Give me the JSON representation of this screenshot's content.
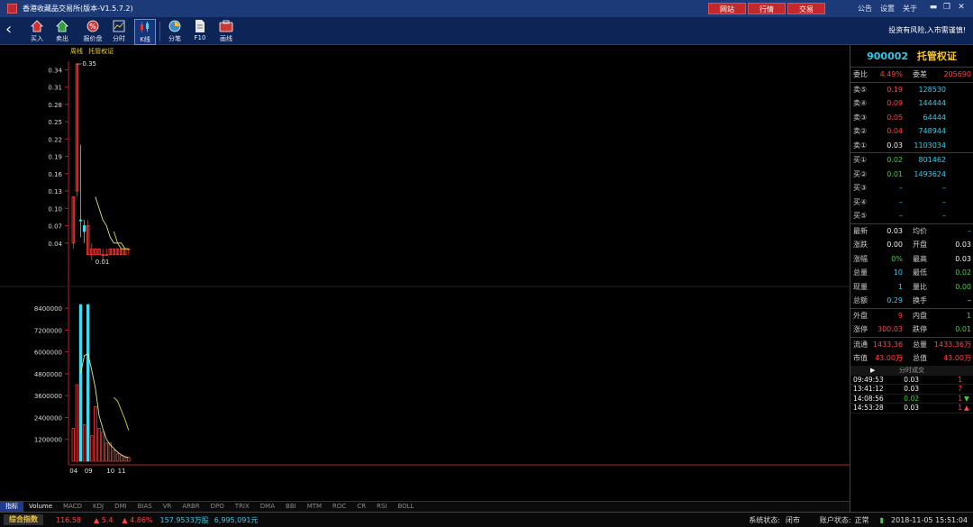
{
  "app": {
    "title": "香港收藏品交易所(版本-V1.5.7.2)",
    "top_buttons": [
      "网站",
      "行情",
      "交易"
    ],
    "top_links": [
      "公告",
      "设置",
      "关于"
    ],
    "window_controls": [
      "minimize-icon",
      "restore-icon",
      "close-icon"
    ]
  },
  "toolbar": {
    "items": [
      {
        "label": "买入",
        "icon": "buy-icon"
      },
      {
        "label": "卖出",
        "icon": "sell-icon"
      },
      {
        "label": "报价盘",
        "icon": "quote-icon"
      },
      {
        "label": "分时",
        "icon": "timeshare-icon"
      },
      {
        "label": "K线",
        "icon": "kline-icon"
      },
      {
        "label": "分笔",
        "icon": "tick-icon"
      },
      {
        "label": "F10",
        "icon": "f10-icon"
      },
      {
        "label": "画线",
        "icon": "draw-line-icon"
      }
    ],
    "active": "K线",
    "warning": "投资有风险,入市需谨慎!"
  },
  "chart": {
    "legend": [
      "周线",
      "托管权证"
    ],
    "max_marker": "0.35",
    "min_marker": "0.01",
    "price_ticks": [
      "0.34",
      "0.31",
      "0.28",
      "0.25",
      "0.22",
      "0.19",
      "0.16",
      "0.13",
      "0.10",
      "0.07",
      "0.04"
    ],
    "volume_ticks": [
      "8400000",
      "7200000",
      "6000000",
      "4800000",
      "3600000",
      "2400000",
      "1200000"
    ],
    "x_labels": [
      "04",
      "09",
      "10",
      "11"
    ],
    "colors": {
      "up": "#ff3b3b",
      "down": "#40d9ee",
      "ma": "#e6e68a",
      "ma2": "#d8d830",
      "axis": "#b4202a"
    }
  },
  "chart_data": {
    "type": "candlestick",
    "x_tick_labels": [
      "04",
      "09",
      "10",
      "11"
    ],
    "price_ylim": [
      0.01,
      0.35
    ],
    "volume_ylim": [
      0,
      9000000
    ],
    "candles": [
      {
        "open": 0.12,
        "close": 0.04,
        "high": 0.12,
        "low": 0.03
      },
      {
        "open": 0.35,
        "close": 0.13,
        "high": 0.35,
        "low": 0.12
      },
      {
        "open": 0.08,
        "close": 0.08,
        "high": 0.21,
        "low": 0.05
      },
      {
        "open": 0.07,
        "close": 0.06,
        "high": 0.08,
        "low": 0.04
      },
      {
        "open": 0.07,
        "close": 0.02,
        "high": 0.08,
        "low": 0.02
      },
      {
        "open": 0.03,
        "close": 0.02,
        "high": 0.04,
        "low": 0.01
      },
      {
        "open": 0.02,
        "close": 0.03,
        "high": 0.03,
        "low": 0.02
      },
      {
        "open": 0.02,
        "close": 0.03,
        "high": 0.03,
        "low": 0.02
      },
      {
        "open": 0.02,
        "close": 0.02,
        "high": 0.03,
        "low": 0.01
      },
      {
        "open": 0.02,
        "close": 0.02,
        "high": 0.03,
        "low": 0.02
      },
      {
        "open": 0.02,
        "close": 0.03,
        "high": 0.03,
        "low": 0.02
      },
      {
        "open": 0.02,
        "close": 0.03,
        "high": 0.03,
        "low": 0.02
      },
      {
        "open": 0.02,
        "close": 0.03,
        "high": 0.03,
        "low": 0.02
      },
      {
        "open": 0.02,
        "close": 0.03,
        "high": 0.03,
        "low": 0.02
      },
      {
        "open": 0.02,
        "close": 0.03,
        "high": 0.03,
        "low": 0.02
      },
      {
        "open": 0.03,
        "close": 0.03,
        "high": 0.03,
        "low": 0.02
      }
    ],
    "volumes": [
      1800000,
      4200000,
      8600000,
      2000000,
      8600000,
      1400000,
      3000000,
      1800000,
      1600000,
      1000000,
      1000000,
      600000,
      400000,
      300000,
      200000,
      200000
    ],
    "volume_up": [
      true,
      true,
      false,
      true,
      false,
      true,
      true,
      true,
      true,
      true,
      true,
      true,
      true,
      true,
      true,
      true
    ],
    "ma_price": [
      {
        "i": 6,
        "v": 0.12
      },
      {
        "i": 7,
        "v": 0.1
      },
      {
        "i": 8,
        "v": 0.08
      },
      {
        "i": 9,
        "v": 0.07
      },
      {
        "i": 10,
        "v": 0.05
      },
      {
        "i": 11,
        "v": 0.04
      },
      {
        "i": 12,
        "v": 0.04
      },
      {
        "i": 13,
        "v": 0.04
      },
      {
        "i": 14,
        "v": 0.03
      },
      {
        "i": 15,
        "v": 0.03
      }
    ],
    "ma_price2": [
      {
        "i": 11,
        "v": 0.06
      },
      {
        "i": 12,
        "v": 0.04
      },
      {
        "i": 13,
        "v": 0.03
      },
      {
        "i": 14,
        "v": 0.03
      },
      {
        "i": 15,
        "v": 0.03
      }
    ],
    "ma_volume": [
      {
        "i": 2,
        "v": 4800000
      },
      {
        "i": 3,
        "v": 5800000
      },
      {
        "i": 4,
        "v": 5900000
      },
      {
        "i": 5,
        "v": 5000000
      },
      {
        "i": 6,
        "v": 4000000
      },
      {
        "i": 7,
        "v": 2500000
      },
      {
        "i": 8,
        "v": 1800000
      },
      {
        "i": 9,
        "v": 1200000
      },
      {
        "i": 10,
        "v": 900000
      },
      {
        "i": 11,
        "v": 700000
      },
      {
        "i": 12,
        "v": 500000
      },
      {
        "i": 13,
        "v": 350000
      },
      {
        "i": 14,
        "v": 250000
      },
      {
        "i": 15,
        "v": 200000
      }
    ],
    "ma_volume2": [
      {
        "i": 11,
        "v": 3500000
      },
      {
        "i": 12,
        "v": 3300000
      },
      {
        "i": 13,
        "v": 2800000
      },
      {
        "i": 14,
        "v": 2300000
      },
      {
        "i": 15,
        "v": 1700000
      }
    ]
  },
  "indicator_tabs": [
    "指标",
    "Volume",
    "MACD",
    "KDJ",
    "DMI",
    "BIAS",
    "VR",
    "ARBR",
    "DPO",
    "TRIX",
    "DMA",
    "BBI",
    "MTM",
    "ROC",
    "CR",
    "RSI",
    "BOLL"
  ],
  "quote": {
    "code": "900002",
    "name": "托管权证",
    "wei_bi": {
      "label": "委比",
      "value": "4.49%",
      "label2": "委差",
      "value2": "205690"
    },
    "sells": [
      {
        "label": "卖⑤",
        "price": "0.19",
        "vol": "128530"
      },
      {
        "label": "卖④",
        "price": "0.09",
        "vol": "144444"
      },
      {
        "label": "卖③",
        "price": "0.05",
        "vol": "64444"
      },
      {
        "label": "卖②",
        "price": "0.04",
        "vol": "748944"
      },
      {
        "label": "卖①",
        "price": "0.03",
        "vol": "1103034"
      }
    ],
    "buys": [
      {
        "label": "买①",
        "price": "0.02",
        "vol": "801462"
      },
      {
        "label": "买②",
        "price": "0.01",
        "vol": "1493624"
      },
      {
        "label": "买③",
        "price": "–",
        "vol": "–"
      },
      {
        "label": "买④",
        "price": "–",
        "vol": "–"
      },
      {
        "label": "买⑤",
        "price": "–",
        "vol": "–"
      }
    ],
    "stats": [
      {
        "l1": "最新",
        "v1": "0.03",
        "l2": "均价",
        "v2": "–"
      },
      {
        "l1": "涨跌",
        "v1": "0.00",
        "l2": "开盘",
        "v2": "0.03"
      },
      {
        "l1": "涨幅",
        "v1": "0%",
        "l2": "最高",
        "v2": "0.03"
      },
      {
        "l1": "总量",
        "v1": "10",
        "l2": "最低",
        "v2": "0.02"
      },
      {
        "l1": "现量",
        "v1": "1",
        "l2": "量比",
        "v2": "0.00"
      },
      {
        "l1": "总额",
        "v1": "0.29",
        "l2": "换手",
        "v2": "–"
      }
    ],
    "stats2": [
      {
        "l1": "外盘",
        "v1": "9",
        "l2": "内盘",
        "v2": "1"
      },
      {
        "l1": "涨停",
        "v1": "300.03",
        "l2": "跌停",
        "v2": "0.01"
      }
    ],
    "stats3": [
      {
        "l1": "流通",
        "v1": "1433.36万",
        "l2": "总量",
        "v2": "1433.36万"
      },
      {
        "l1": "市值",
        "v1": "43.00万",
        "l2": "总值",
        "v2": "43.00万"
      }
    ],
    "trades_header": "分时成交",
    "trades": [
      {
        "time": "09:49:53",
        "price": "0.03",
        "vol": "1",
        "flag": ""
      },
      {
        "time": "13:41:12",
        "price": "0.03",
        "vol": "7",
        "flag": ""
      },
      {
        "time": "14:08:56",
        "price": "0.02",
        "vol": "1",
        "flag": "▼"
      },
      {
        "time": "14:53:28",
        "price": "0.03",
        "vol": "1",
        "flag": "▲"
      }
    ]
  },
  "status": {
    "index_label": "综合指数",
    "index_value": "116.58",
    "change": "▲ 5.4",
    "change_pct": "▲ 4.86%",
    "volume": "157.9533万股",
    "amount": "6,995,091元",
    "sys_label": "系统状态:",
    "sys_value": "闭市",
    "acct_label": "账户状态:",
    "acct_value": "正常",
    "datetime": "2018-11-05 15:51:04"
  }
}
